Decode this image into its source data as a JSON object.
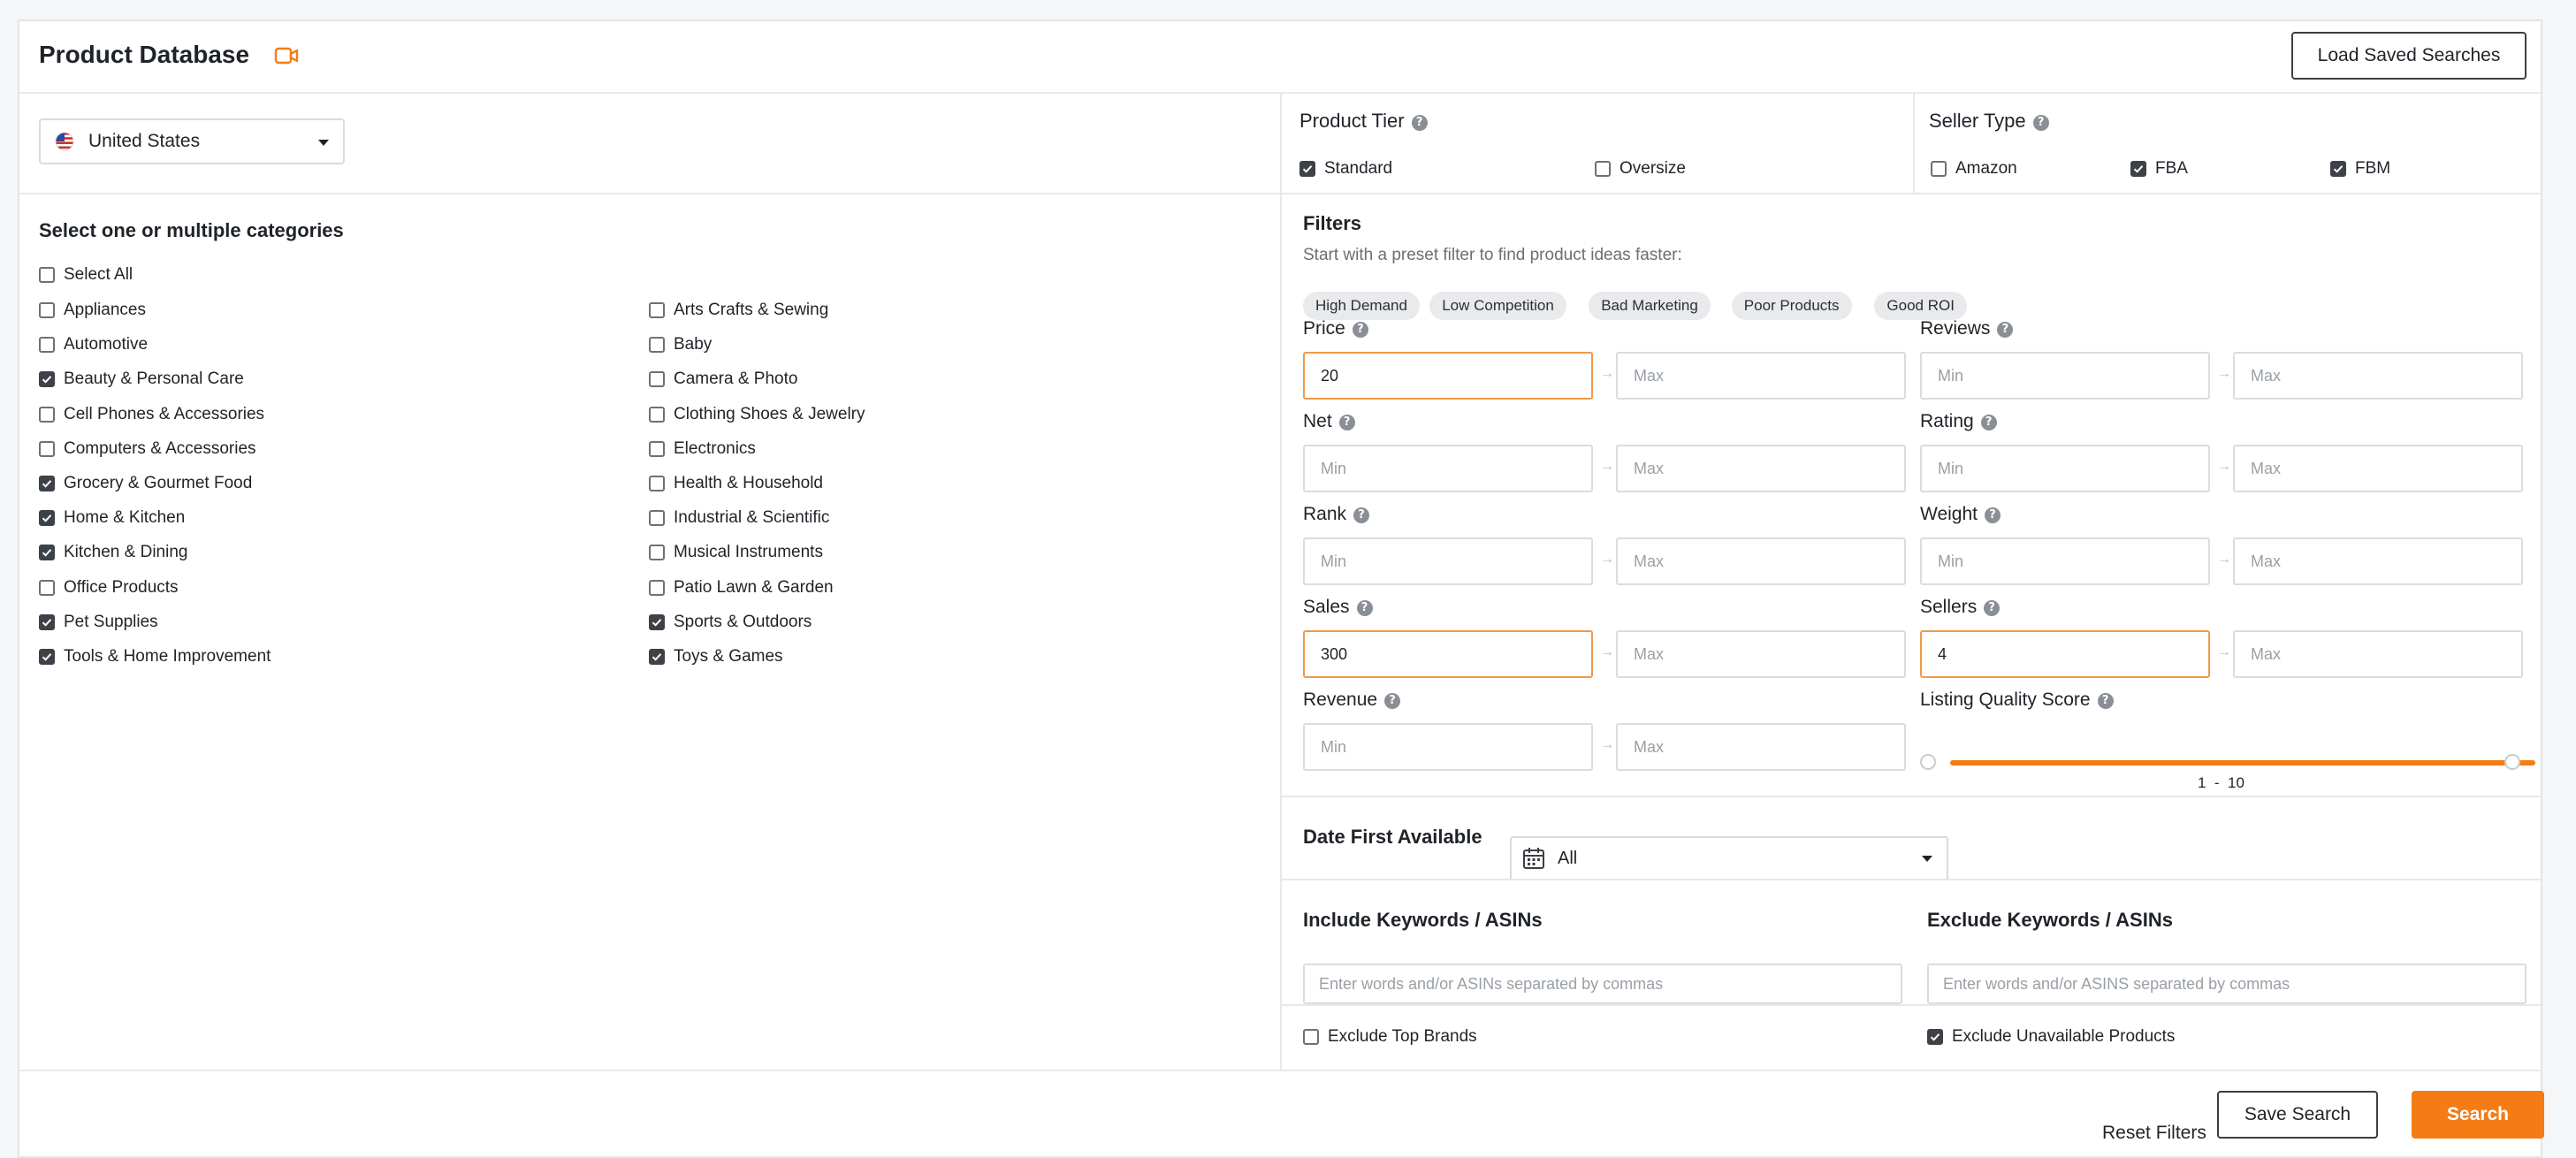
{
  "header": {
    "title": "Product Database",
    "load_saved_label": "Load Saved Searches"
  },
  "country": {
    "label": "United States"
  },
  "categories": {
    "title": "Select one or multiple categories",
    "select_all": {
      "label": "Select All",
      "checked": false
    },
    "left": [
      {
        "label": "Appliances",
        "checked": false
      },
      {
        "label": "Automotive",
        "checked": false
      },
      {
        "label": "Beauty & Personal Care",
        "checked": true
      },
      {
        "label": "Cell Phones & Accessories",
        "checked": false
      },
      {
        "label": "Computers & Accessories",
        "checked": false
      },
      {
        "label": "Grocery & Gourmet Food",
        "checked": true
      },
      {
        "label": "Home & Kitchen",
        "checked": true
      },
      {
        "label": "Kitchen & Dining",
        "checked": true
      },
      {
        "label": "Office Products",
        "checked": false
      },
      {
        "label": "Pet Supplies",
        "checked": true
      },
      {
        "label": "Tools & Home Improvement",
        "checked": true
      }
    ],
    "right": [
      {
        "label": "Arts Crafts & Sewing",
        "checked": false
      },
      {
        "label": "Baby",
        "checked": false
      },
      {
        "label": "Camera & Photo",
        "checked": false
      },
      {
        "label": "Clothing Shoes & Jewelry",
        "checked": false
      },
      {
        "label": "Electronics",
        "checked": false
      },
      {
        "label": "Health & Household",
        "checked": false
      },
      {
        "label": "Industrial & Scientific",
        "checked": false
      },
      {
        "label": "Musical Instruments",
        "checked": false
      },
      {
        "label": "Patio Lawn & Garden",
        "checked": false
      },
      {
        "label": "Sports & Outdoors",
        "checked": true
      },
      {
        "label": "Toys & Games",
        "checked": true
      }
    ]
  },
  "product_tier": {
    "title": "Product Tier",
    "options": [
      {
        "label": "Standard",
        "checked": true
      },
      {
        "label": "Oversize",
        "checked": false
      }
    ]
  },
  "seller_type": {
    "title": "Seller Type",
    "options": [
      {
        "label": "Amazon",
        "checked": false
      },
      {
        "label": "FBA",
        "checked": true
      },
      {
        "label": "FBM",
        "checked": true
      }
    ]
  },
  "filters": {
    "title": "Filters",
    "subtitle": "Start with a preset filter to find product ideas faster:",
    "presets": [
      "High Demand",
      "Low Competition",
      "Bad Marketing",
      "Poor Products",
      "Good ROI"
    ],
    "min_placeholder": "Min",
    "max_placeholder": "Max",
    "price": {
      "label": "Price",
      "min": "20",
      "max": ""
    },
    "reviews": {
      "label": "Reviews",
      "min": "",
      "max": ""
    },
    "net": {
      "label": "Net",
      "min": "",
      "max": ""
    },
    "rating": {
      "label": "Rating",
      "min": "",
      "max": ""
    },
    "rank": {
      "label": "Rank",
      "min": "",
      "max": ""
    },
    "weight": {
      "label": "Weight",
      "min": "",
      "max": ""
    },
    "sales": {
      "label": "Sales",
      "min": "300",
      "max": ""
    },
    "sellers": {
      "label": "Sellers",
      "min": "4",
      "max": ""
    },
    "revenue": {
      "label": "Revenue",
      "min": "",
      "max": ""
    },
    "lqs": {
      "label": "Listing Quality Score",
      "min": "1",
      "max": "10",
      "separator": "-"
    }
  },
  "date_first_available": {
    "label": "Date First Available",
    "value": "All"
  },
  "keywords": {
    "include_label": "Include Keywords / ASINs",
    "exclude_label": "Exclude Keywords / ASINs",
    "include_placeholder": "Enter words and/or ASINs separated by commas",
    "exclude_placeholder": "Enter words and/or ASINS separated by commas"
  },
  "exclusions": {
    "top_brands": {
      "label": "Exclude Top Brands",
      "checked": false
    },
    "unavailable": {
      "label": "Exclude Unavailable Products",
      "checked": true
    }
  },
  "footer": {
    "reset_label": "Reset Filters",
    "save_label": "Save Search",
    "search_label": "Search"
  },
  "colors": {
    "accent": "#f57c14",
    "checkbox_checked": "#3d4148",
    "active_input_border": "#f0994a"
  }
}
